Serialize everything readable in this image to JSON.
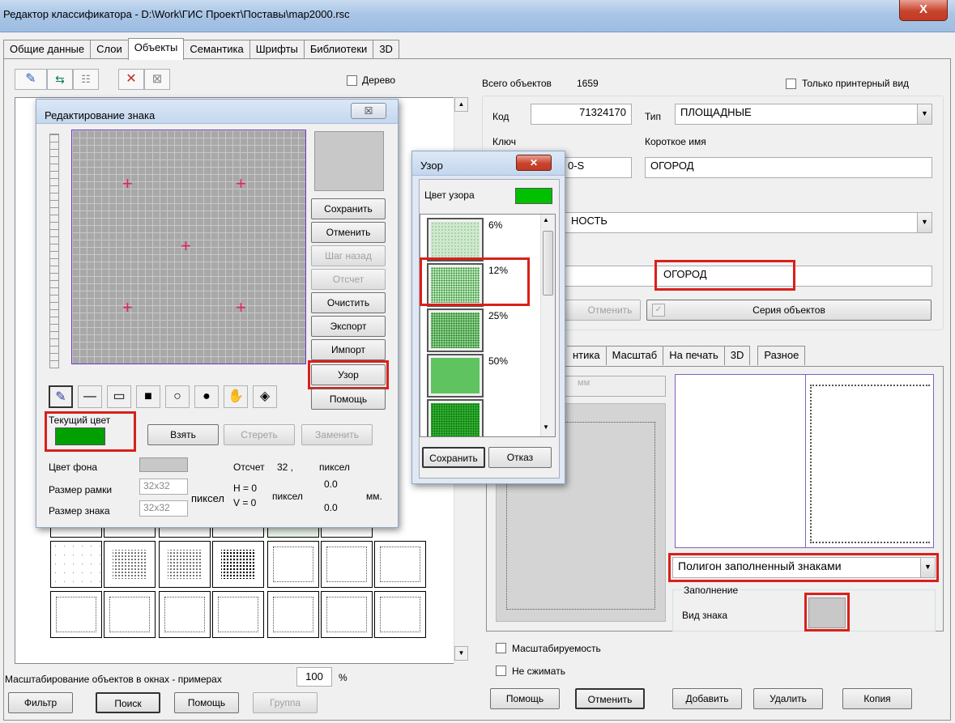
{
  "window": {
    "title": "Редактор классификатора - D:\\Work\\ГИС Проект\\Поставы\\map2000.rsc",
    "close": "X"
  },
  "tabs": [
    "Общие данные",
    "Слои",
    "Объекты",
    "Семантика",
    "Шрифты",
    "Библиотеки",
    "3D"
  ],
  "left": {
    "tree_label": "Дерево",
    "scale_label": "Масштабирование объектов в окнах - примерах",
    "scale_value": "100",
    "scale_unit": "%",
    "buttons": {
      "filter": "Фильтр",
      "search": "Поиск",
      "help": "Помощь",
      "group": "Группа"
    }
  },
  "right": {
    "total_label": "Всего объектов",
    "total_value": "1659",
    "printer_only": "Только принтерный вид",
    "code_label": "Код",
    "code_value": "71324170",
    "type_label": "Тип",
    "type_value": "ПЛОЩАДНЫЕ",
    "key_label": "Ключ",
    "key_value": "0-S",
    "short_name_label": "Короткое имя",
    "short_name_value": "ОГОРОД",
    "layer_value": "НОСТЬ",
    "name_value": "ОГОРОД",
    "cancel_mid": "Отменить",
    "series": "Серия объектов",
    "subtabs": [
      "нтика",
      "Масштаб",
      "На печать",
      "3D",
      "Разное"
    ],
    "unit_mm": "мм",
    "fill_type": "Полигон заполненный знаками",
    "fill_group": "Заполнение",
    "sign_view": "Вид знака",
    "scalable": "Масштабируемость",
    "no_compress": "Не сжимать",
    "bottom_buttons": {
      "help": "Помощь",
      "cancel": "Отменить",
      "add": "Добавить",
      "delete": "Удалить",
      "copy": "Копия"
    }
  },
  "sign_editor": {
    "title": "Редактирование знака",
    "close": "☒",
    "buttons": [
      "Сохранить",
      "Отменить",
      "Шаг назад",
      "Отсчет",
      "Очистить",
      "Экспорт",
      "Импорт",
      "Узор",
      "Помощь"
    ],
    "current_color_label": "Текущий цвет",
    "current_color": "#00a000",
    "take": "Взять",
    "erase": "Стереть",
    "replace": "Заменить",
    "bg_color_label": "Цвет фона",
    "frame_size_label": "Размер рамки",
    "frame_size": "32x32",
    "sign_size_label": "Размер знака",
    "sign_size": "32x32",
    "pixel_unit": "пиксел",
    "offset_label": "Отсчет",
    "offset_value": "32 ,",
    "offset_unit": "пиксел",
    "h_label": "H = 0",
    "v_label": "V = 0",
    "pixel_unit2": "пиксел",
    "mm_h": "0.0",
    "mm_v": "0.0",
    "mm_unit": "мм."
  },
  "pattern_dialog": {
    "title": "Узор",
    "color_label": "Цвет узора",
    "color": "#00c000",
    "items": [
      {
        "percent": "6%"
      },
      {
        "percent": "12%"
      },
      {
        "percent": "25%"
      },
      {
        "percent": "50%"
      },
      {
        "percent": ""
      }
    ],
    "save": "Сохранить",
    "cancel": "Отказ"
  }
}
